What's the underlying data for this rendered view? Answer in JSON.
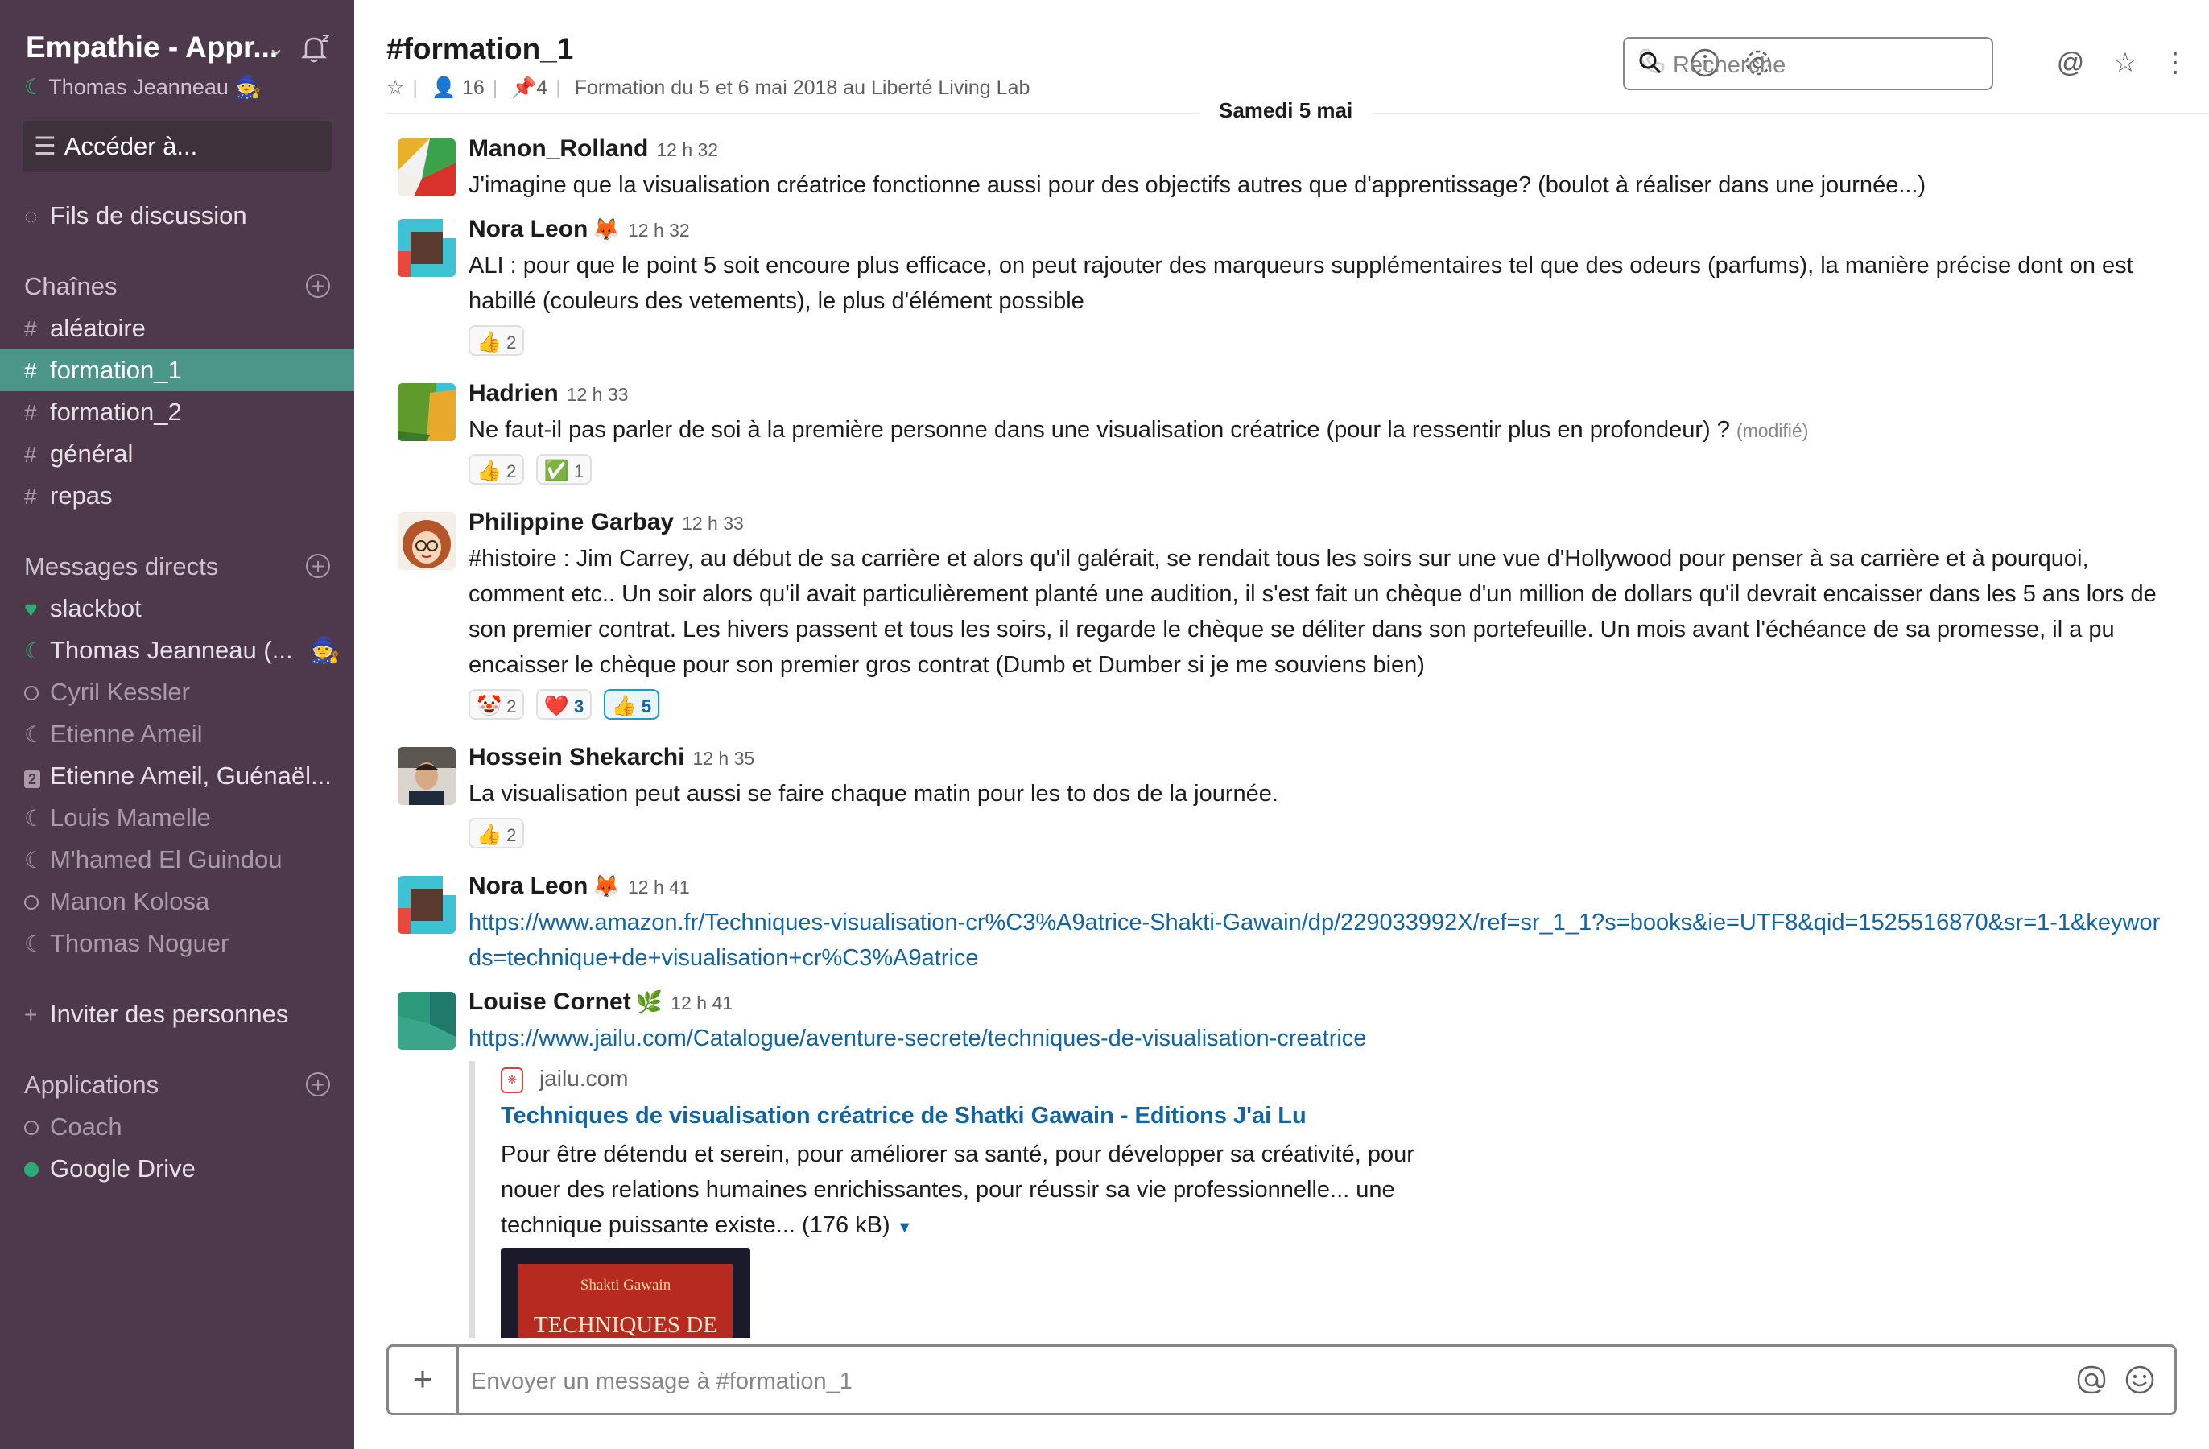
{
  "sidebar": {
    "workspace": "Empathie - Appr...",
    "user": "Thomas Jeanneau",
    "jump_to": "Accéder à...",
    "threads": "Fils de discussion",
    "channels_header": "Chaînes",
    "channels": [
      "aléatoire",
      "formation_1",
      "formation_2",
      "général",
      "repas"
    ],
    "dm_header": "Messages directs",
    "dms": [
      "slackbot",
      "Thomas Jeanneau  (...",
      "Cyril Kessler",
      "Etienne Ameil",
      "Etienne Ameil, Guénaël...",
      "Louis Mamelle",
      "M'hamed El Guindou",
      "Manon Kolosa",
      "Thomas Noguer"
    ],
    "group_dm_count": "2",
    "invite": "Inviter des personnes",
    "apps_header": "Applications",
    "apps": [
      "Coach",
      "Google Drive"
    ]
  },
  "header": {
    "channel": "#formation_1",
    "members": "16",
    "pins": "4",
    "topic": "Formation du 5 et 6 mai 2018 au Liberté Living Lab",
    "search_placeholder": "Recherche"
  },
  "day_divider": "Samedi 5 mai",
  "messages": [
    {
      "author": "Manon_Rolland",
      "time": "12 h 32",
      "text": "J'imagine que la visualisation créatrice fonctionne aussi pour des objectifs autres que d'apprentissage? (boulot à réaliser dans une journée...)"
    },
    {
      "author": "Nora Leon",
      "time": "12 h 32",
      "text": "ALI : pour que le point 5 soit encoure plus efficace, on peut rajouter des marqueurs supplémentaires tel que des odeurs (parfums), la manière précise dont on est habillé (couleurs des vetements), le plus d'élément possible",
      "reactions": [
        {
          "emoji": "👍",
          "count": "2"
        }
      ]
    },
    {
      "author": "Hadrien",
      "time": "12 h 33",
      "text": "Ne faut-il pas parler de soi à la première personne dans une visualisation créatrice (pour la ressentir plus en profondeur) ?",
      "edited": "(modifié)",
      "reactions": [
        {
          "emoji": "👍",
          "count": "2"
        },
        {
          "emoji": "✅",
          "count": "1"
        }
      ]
    },
    {
      "author": "Philippine Garbay",
      "time": "12 h 33",
      "text": "#histoire : Jim Carrey, au début de sa carrière et alors qu'il galérait, se rendait tous les soirs sur une vue d'Hollywood pour penser à sa carrière et à pourquoi, comment etc.. Un soir alors qu'il avait particulièrement planté une audition, il s'est fait un chèque d'un million de dollars qu'il devrait encaisser dans les 5 ans lors de son premier contrat. Les hivers passent et tous les soirs, il regarde le chèque se déliter dans son portefeuille. Un mois avant l'échéance de sa promesse, il a pu encaisser le chèque pour son premier gros contrat (Dumb et Dumber si je me souviens bien)",
      "reactions": [
        {
          "emoji": "🤡",
          "count": "2"
        },
        {
          "emoji": "❤️",
          "count": "3"
        },
        {
          "emoji": "👍",
          "count": "5"
        }
      ]
    },
    {
      "author": "Hossein Shekarchi",
      "time": "12 h 35",
      "text": "La visualisation peut aussi se faire chaque matin pour les to dos de la journée.",
      "reactions": [
        {
          "emoji": "👍",
          "count": "2"
        }
      ]
    },
    {
      "author": "Nora Leon",
      "time": "12 h 41",
      "link": "https://www.amazon.fr/Techniques-visualisation-cr%C3%A9atrice-Shakti-Gawain/dp/229033992X/ref=sr_1_1?s=books&ie=UTF8&qid=1525516870&sr=1-1&keywords=technique+de+visualisation+cr%C3%A9atrice"
    },
    {
      "author": "Louise Cornet",
      "time": "12 h 41",
      "link": "https://www.jailu.com/Catalogue/aventure-secrete/techniques-de-visualisation-creatrice"
    }
  ],
  "unfurl": {
    "site": "jailu.com",
    "title": "Techniques de visualisation créatrice de Shatki Gawain - Editions J'ai Lu",
    "description": "Pour être détendu et serein, pour améliorer sa santé, pour développer sa créativité, pour nouer des relations humaines enrichissantes, pour réussir sa vie professionnelle... une technique puissante existe...",
    "size": "(176 kB)",
    "image_author": "Shakti Gawain",
    "image_title": "TECHNIQUES DE VISUALISATION"
  },
  "composer": {
    "placeholder": "Envoyer un message à #formation_1"
  },
  "colors": {
    "sidebar": "#4d394b",
    "active": "#4c9689",
    "link": "#1264a3",
    "presence": "#2bac76"
  }
}
